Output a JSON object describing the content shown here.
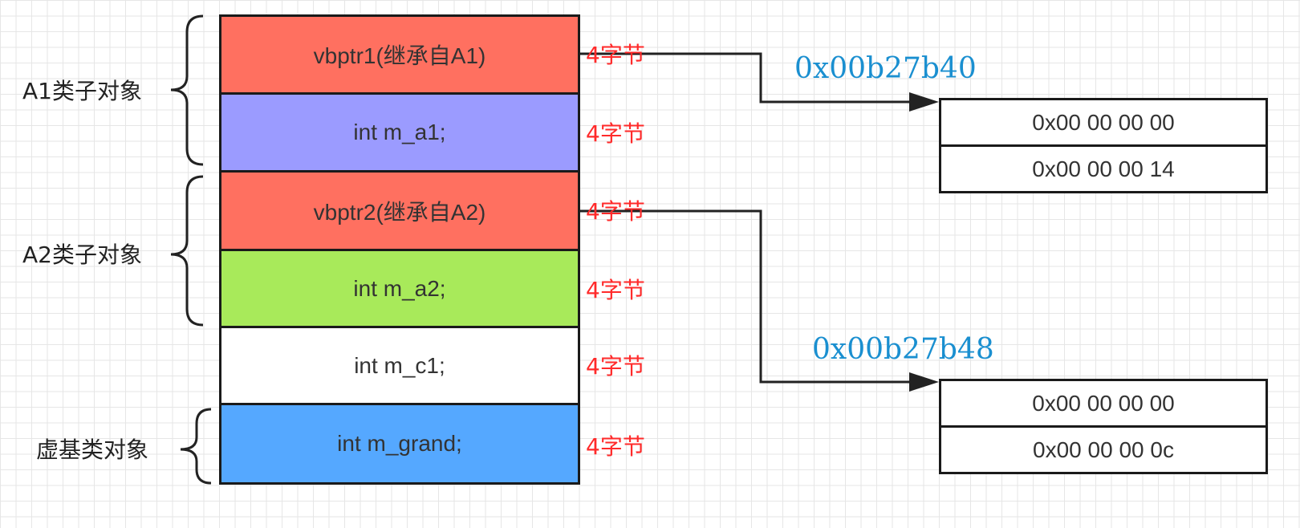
{
  "memory_cells": [
    {
      "text": "vbptr1(继承自A1)",
      "size": "4字节",
      "color": "#ff7060"
    },
    {
      "text": "int m_a1;",
      "size": "4字节",
      "color": "#9b9bff"
    },
    {
      "text": "vbptr2(继承自A2)",
      "size": "4字节",
      "color": "#ff7060"
    },
    {
      "text": "int m_a2;",
      "size": "4字节",
      "color": "#a8ea5a"
    },
    {
      "text": "int m_c1;",
      "size": "4字节",
      "color": "#ffffff"
    },
    {
      "text": "int m_grand;",
      "size": "4字节",
      "color": "#55a8ff"
    }
  ],
  "groups": [
    {
      "label": "A1类子对象"
    },
    {
      "label": "A2类子对象"
    },
    {
      "label": "虚基类对象"
    }
  ],
  "vbtables": [
    {
      "address": "0x00b27b40",
      "rows": [
        "0x00 00 00 00",
        "0x00 00 00 14"
      ]
    },
    {
      "address": "0x00b27b48",
      "rows": [
        "0x00 00 00 00",
        "0x00 00 00 0c"
      ]
    }
  ],
  "colors": {
    "pointer_cell": "#ff7060",
    "m_a1_cell": "#9b9bff",
    "m_a2_cell": "#a8ea5a",
    "m_c1_cell": "#ffffff",
    "m_grand_cell": "#55a8ff",
    "size_label": "#ff2a2a",
    "address_text": "#1a8fd0"
  }
}
